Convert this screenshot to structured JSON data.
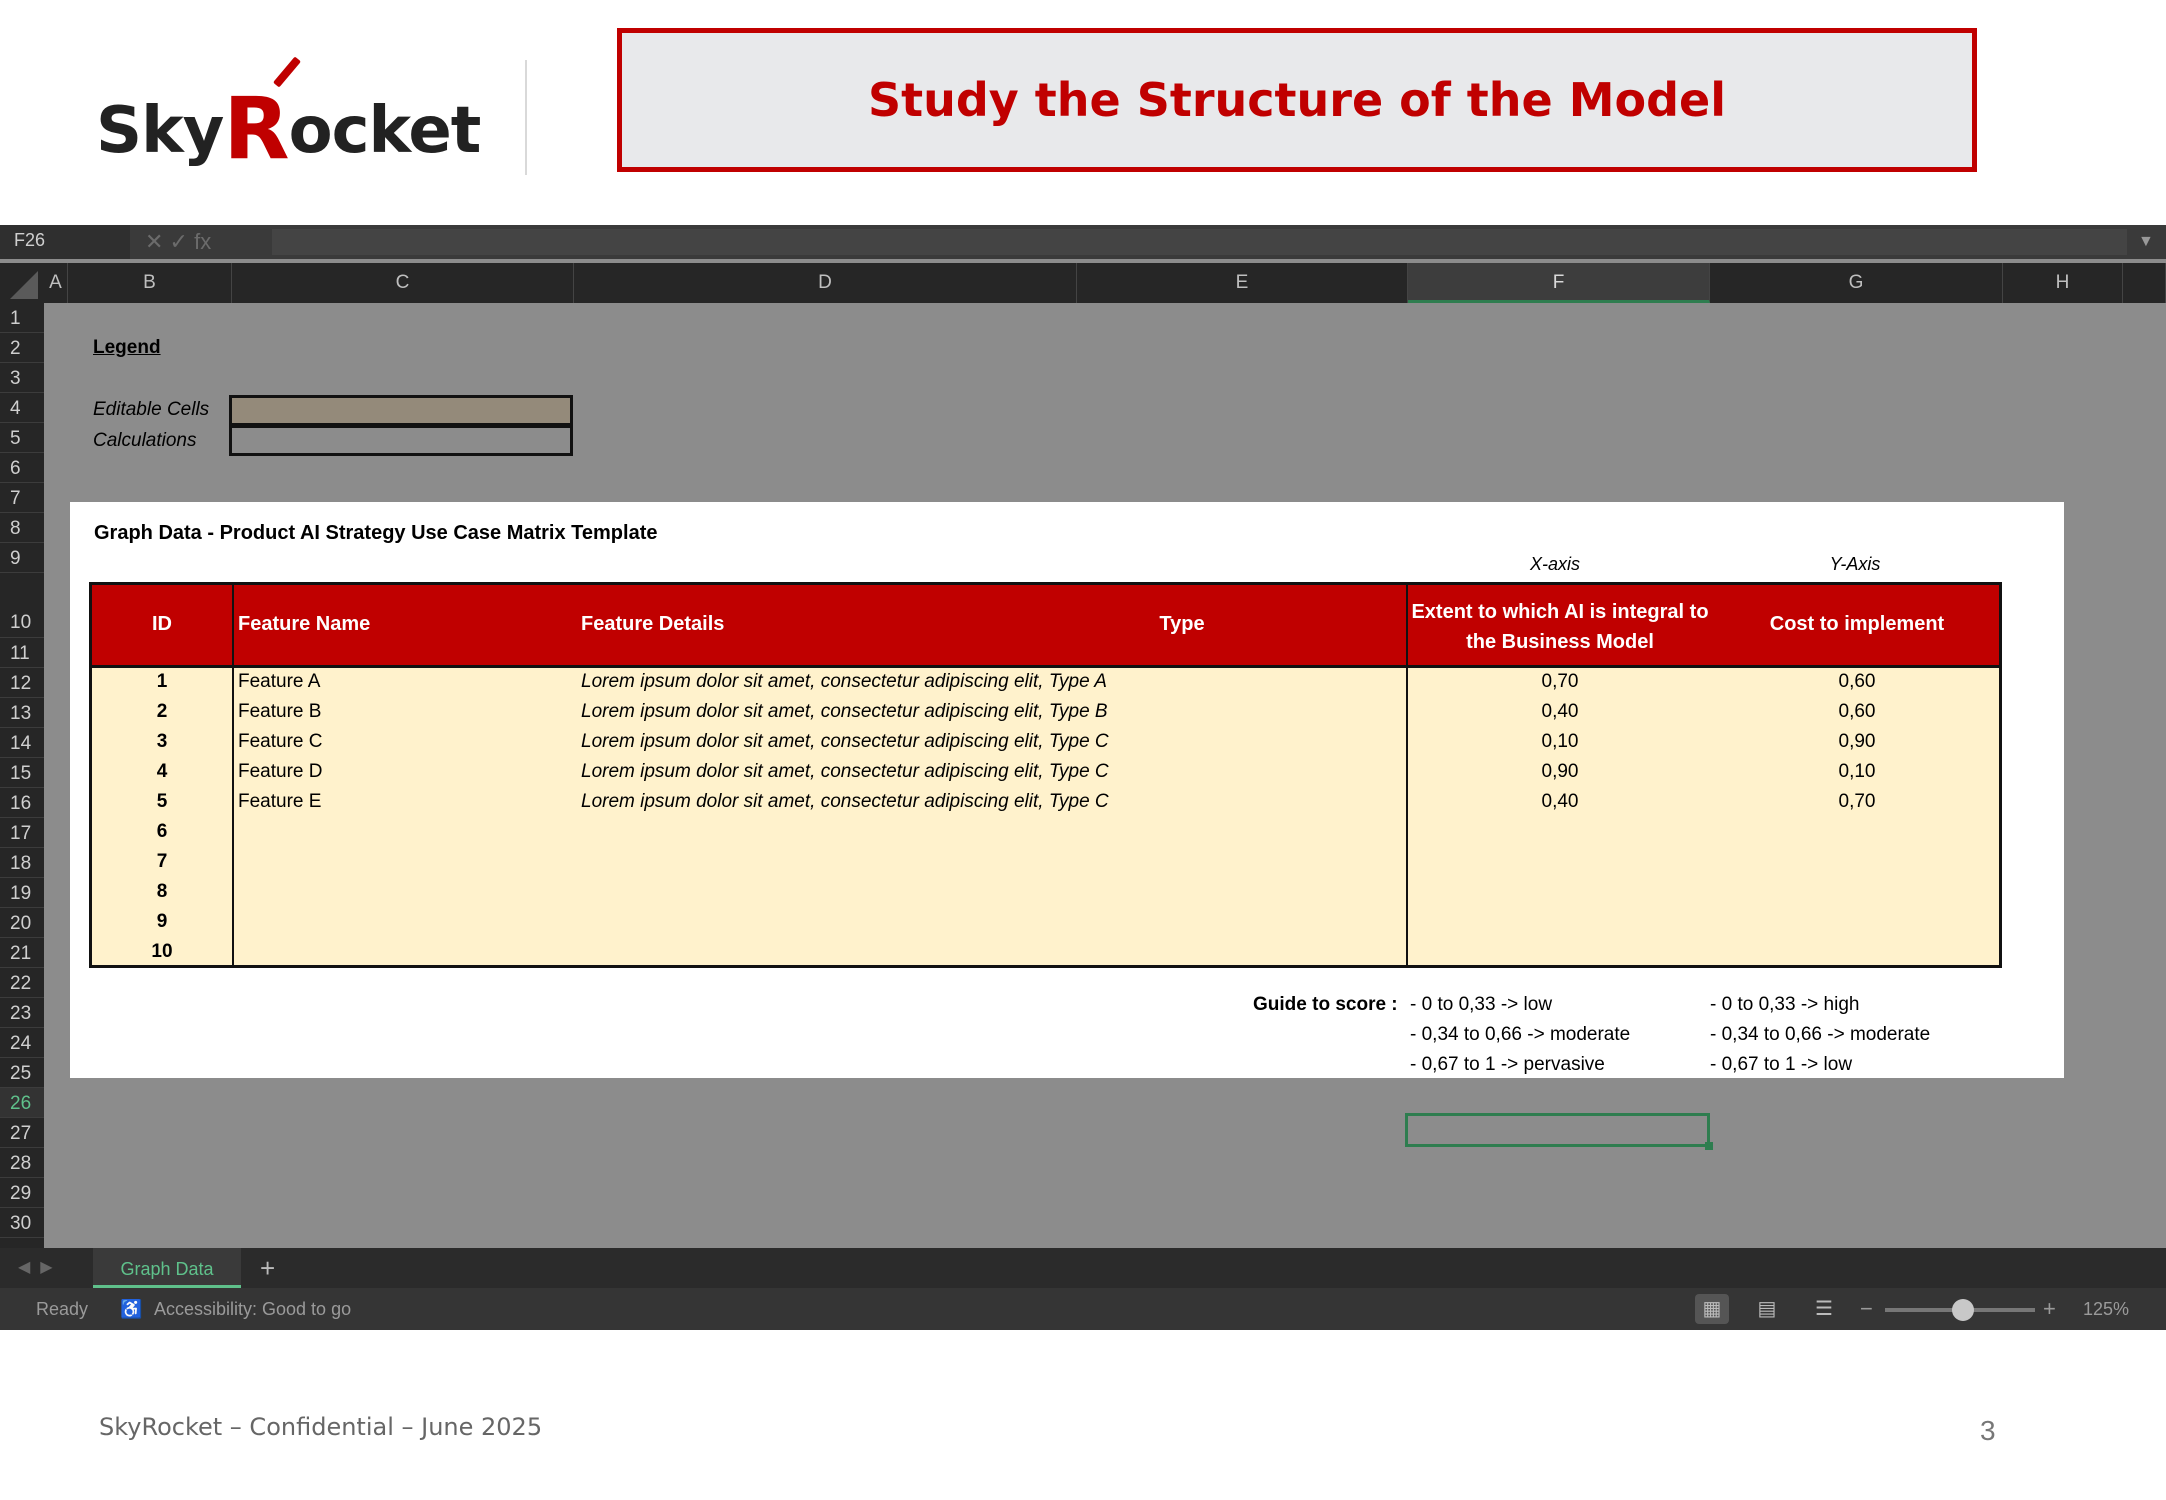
{
  "header": {
    "logo_text_1": "Sky",
    "logo_text_r": "R",
    "logo_text_2": "ocket",
    "title": "Study the Structure of the Model"
  },
  "excel": {
    "name_box": "F26",
    "formula_icons": "✕  ✓  fx",
    "columns": [
      "A",
      "B",
      "C",
      "D",
      "E",
      "F",
      "G",
      "H"
    ],
    "selected_column": "F",
    "rows": [
      "1",
      "2",
      "3",
      "4",
      "5",
      "6",
      "7",
      "8",
      "9",
      "10",
      "11",
      "12",
      "13",
      "14",
      "15",
      "16",
      "17",
      "18",
      "19",
      "20",
      "21",
      "22",
      "23",
      "24",
      "25",
      "26",
      "27",
      "28",
      "29",
      "30"
    ],
    "selected_row": "26",
    "legend": {
      "title": "Legend",
      "editable_label": "Editable Cells",
      "calculations_label": "Calculations",
      "editable_color": "#948a7a",
      "calculations_color": "#8c8c8c"
    },
    "card": {
      "title": "Graph Data - Product AI Strategy Use Case Matrix Template",
      "x_axis_label": "X-axis",
      "y_axis_label": "Y-Axis",
      "headers": {
        "id": "ID",
        "name": "Feature Name",
        "details": "Feature Details",
        "type": "Type",
        "x": "Extent to which AI is integral to the Business Model",
        "y": "Cost to implement"
      },
      "table_rows": [
        {
          "id": "1",
          "name": "Feature A",
          "details": "Lorem ipsum dolor sit amet, consectetur adipiscing elit, Type A",
          "x": "0,70",
          "y": "0,60"
        },
        {
          "id": "2",
          "name": "Feature B",
          "details": "Lorem ipsum dolor sit amet, consectetur adipiscing elit, Type B",
          "x": "0,40",
          "y": "0,60"
        },
        {
          "id": "3",
          "name": "Feature C",
          "details": "Lorem ipsum dolor sit amet, consectetur adipiscing elit, Type C",
          "x": "0,10",
          "y": "0,90"
        },
        {
          "id": "4",
          "name": "Feature D",
          "details": "Lorem ipsum dolor sit amet, consectetur adipiscing elit, Type C",
          "x": "0,90",
          "y": "0,10"
        },
        {
          "id": "5",
          "name": "Feature E",
          "details": "Lorem ipsum dolor sit amet, consectetur adipiscing elit, Type C",
          "x": "0,40",
          "y": "0,70"
        },
        {
          "id": "6",
          "name": "",
          "details": "",
          "x": "",
          "y": ""
        },
        {
          "id": "7",
          "name": "",
          "details": "",
          "x": "",
          "y": ""
        },
        {
          "id": "8",
          "name": "",
          "details": "",
          "x": "",
          "y": ""
        },
        {
          "id": "9",
          "name": "",
          "details": "",
          "x": "",
          "y": ""
        },
        {
          "id": "10",
          "name": "",
          "details": "",
          "x": "",
          "y": ""
        }
      ],
      "guide_label": "Guide to score :",
      "guide_x": [
        "- 0 to 0,33 -> low",
        "- 0,34 to 0,66 -> moderate",
        "- 0,67 to 1 -> pervasive"
      ],
      "guide_y": [
        "- 0 to 0,33 -> high",
        "- 0,34 to 0,66 -> moderate",
        "- 0,67 to 1 -> low"
      ]
    },
    "sheet_tab": "Graph Data",
    "add_sheet": "+",
    "status": {
      "ready": "Ready",
      "accessibility": "Accessibility: Good to go",
      "zoom": "125%"
    }
  },
  "footer": {
    "text": "SkyRocket – Confidential – June 2025",
    "page": "3"
  },
  "colors": {
    "brand_red": "#c00000",
    "input_fill": "#fff2cc",
    "excel_green": "#2e7d4f"
  }
}
